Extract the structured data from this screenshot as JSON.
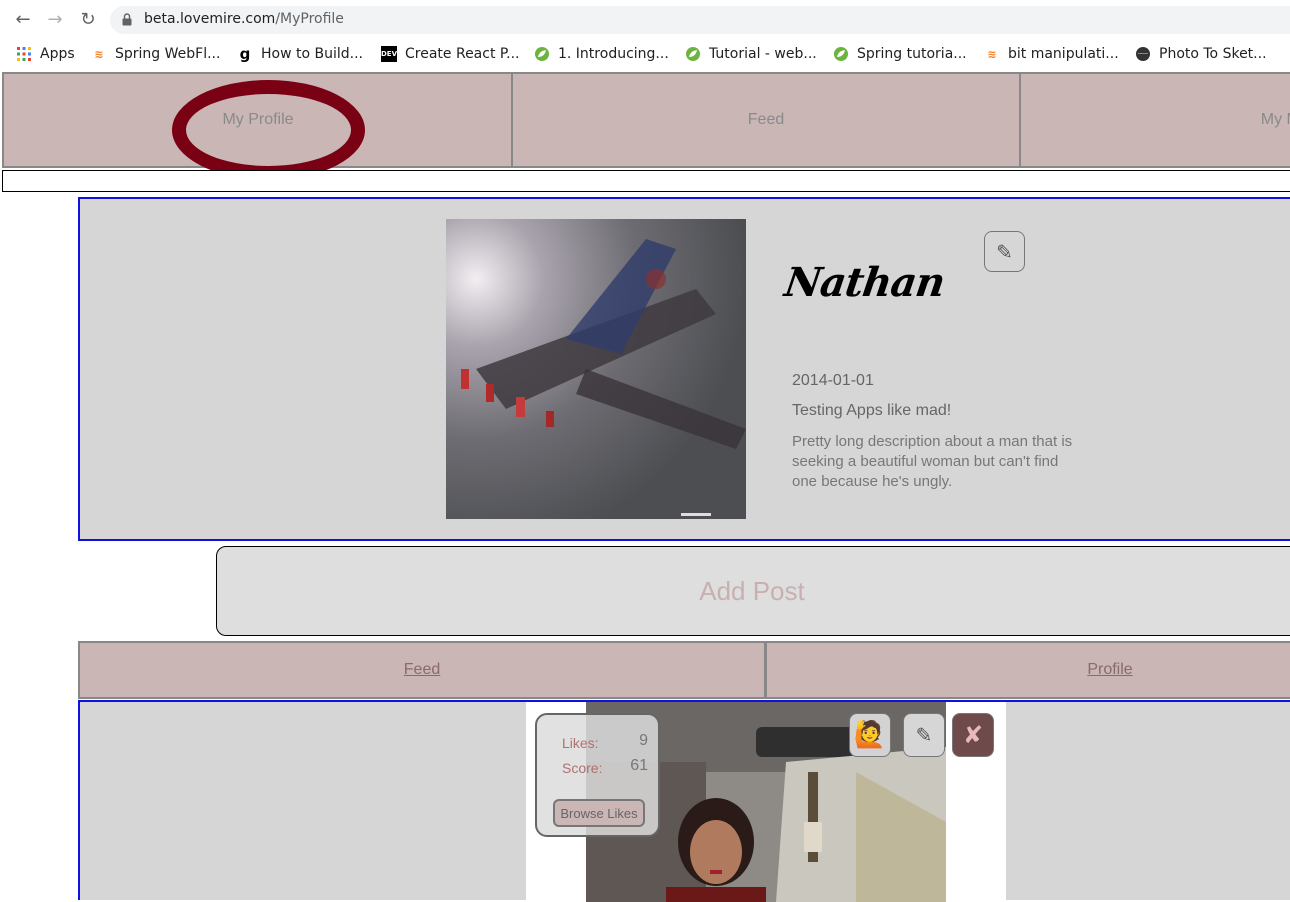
{
  "browser": {
    "url_host": "beta.lovemire.com",
    "url_path": "/MyProfile",
    "bookmarks": [
      {
        "label": "Apps",
        "icon": "apps-grid-icon"
      },
      {
        "label": "Spring WebFl...",
        "icon": "stackoverflow-icon"
      },
      {
        "label": "How to Build...",
        "icon": "g-icon"
      },
      {
        "label": "Create React P...",
        "icon": "dev-icon"
      },
      {
        "label": "1. Introducing...",
        "icon": "spring-icon"
      },
      {
        "label": "Tutorial - web...",
        "icon": "spring-icon"
      },
      {
        "label": "Spring tutoria...",
        "icon": "spring-icon"
      },
      {
        "label": "bit manipulati...",
        "icon": "stackoverflow-icon"
      },
      {
        "label": "Photo To Sket...",
        "icon": "circle-dark-icon"
      }
    ]
  },
  "topnav": {
    "items": [
      {
        "label": "My Profile"
      },
      {
        "label": "Feed"
      },
      {
        "label": "My Matc"
      }
    ]
  },
  "profile": {
    "name": "Nathan",
    "dob": "2014-01-01",
    "tagline": "Testing Apps like mad!",
    "description": "Pretty long description about a man that is seeking a beautiful woman but can't find one because he's ungly.",
    "edit_icon": "✎"
  },
  "add_post": {
    "label": "Add Post"
  },
  "subnav": {
    "items": [
      {
        "label": "Feed"
      },
      {
        "label": "Profile"
      }
    ]
  },
  "post": {
    "likes_label": "Likes:",
    "likes": "9",
    "score_label": "Score:",
    "score": "61",
    "browse_likes": "Browse Likes",
    "raise_hand_icon": "🙋",
    "edit_icon": "✎",
    "delete_icon": "✘"
  },
  "colors": {
    "nav_bg": "#c9b6b5",
    "card_bg": "#d6d6d6",
    "card_border": "#1010e0",
    "highlight_circle": "#7a0013",
    "delete_btn": "#6e4a4a"
  }
}
